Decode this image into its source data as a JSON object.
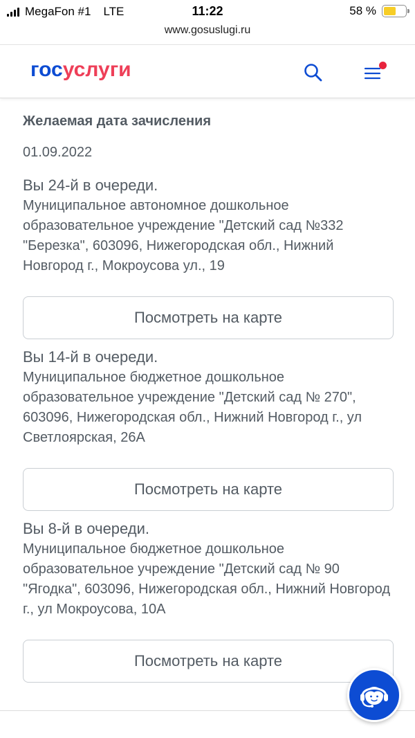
{
  "status_bar": {
    "carrier": "MegaFon #1",
    "network": "LTE",
    "time": "11:22",
    "battery_percent": "58 %",
    "battery_level": 0.58
  },
  "browser": {
    "url": "www.gosuslugi.ru"
  },
  "header": {
    "logo_part1": "гос",
    "logo_part2": "услуги",
    "logo_color_primary": "#0d4cd3",
    "logo_color_accent": "#ee3f58",
    "search_icon": "search-icon",
    "menu_icon": "hamburger-menu-icon",
    "notification_color": "#e8233d"
  },
  "content": {
    "section_title": "Желаемая дата зачисления",
    "desired_date": "01.09.2022",
    "map_button_label": "Посмотреть на карте",
    "queue": [
      {
        "position": "Вы 24-й в очереди.",
        "description": "Муниципальное автономное дошкольное образовательное учреждение \"Детский сад №332 \"Березка\", 603096, Нижегородская обл., Нижний Новгород г., Мокроусова ул., 19"
      },
      {
        "position": "Вы 14-й в очереди.",
        "description": "Муниципальное бюджетное дошкольное образовательное учреждение \"Детский сад № 270\", 603096, Нижегородская обл., Нижний Новгород г., ул Светлоярская, 26А"
      },
      {
        "position": "Вы 8-й в очереди.",
        "description": "Муниципальное бюджетное дошкольное образовательное учреждение \"Детский сад № 90 \"Ягодка\", 603096, Нижегородская обл., Нижний Новгород г., ул Мокроусова, 10А"
      }
    ]
  },
  "support_button": {
    "icon": "support-operator-icon",
    "color": "#0d4cd3"
  }
}
